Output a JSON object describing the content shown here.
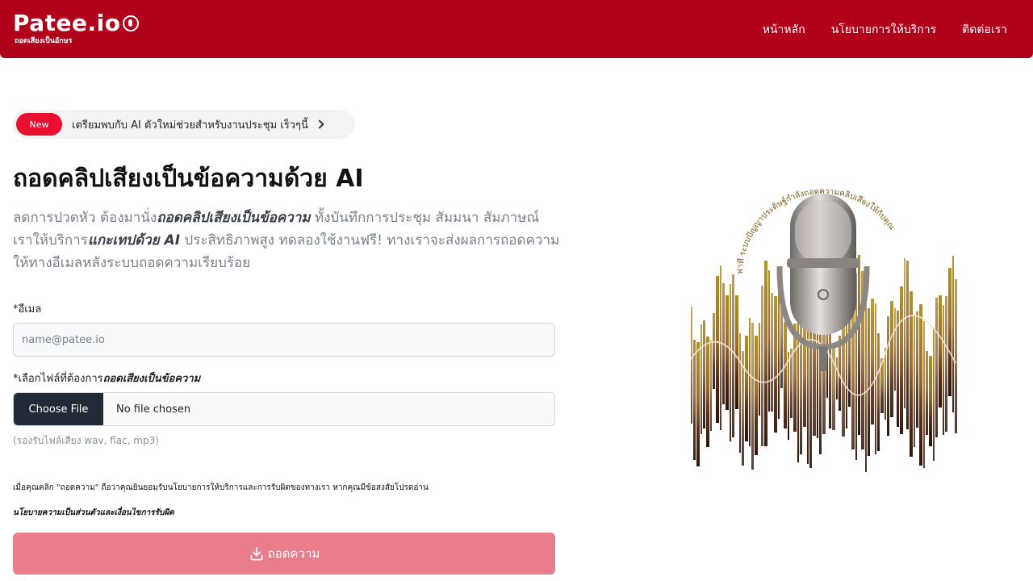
{
  "header": {
    "logo_text": "Patee.io",
    "logo_subtitle": "ถอดเสียงเป็นอักษร",
    "nav": [
      "หน้าหลัก",
      "นโยบายการให้บริการ",
      "ติดต่อเรา"
    ]
  },
  "announcement": {
    "badge": "New",
    "text": "เตรียมพบกับ AI ตัวใหม่ช่วยสำหรับงานประชุม เร็วๆนี้",
    "icon": "chevron-right-icon"
  },
  "hero": {
    "title": "ถอดคลิปเสียงเป็นข้อความด้วย AI",
    "lead_1": "ลดการปวดหัว ต้องมานั่ง",
    "lead_1_em": "ถอดคลิปเสียงเป็นข้อความ",
    "lead_2": " ทั้งบันทึกการประชุม สัมมนา สัมภาษณ์ เราให้บริการ",
    "lead_2_em": "แกะเทปด้วย AI",
    "lead_3": " ประสิทธิภาพสูง ทดลองใช้งานฟรี! ทางเราจะส่งผลการถอดความให้ทางอีเมลหลังระบบถอดความเรียบร้อย"
  },
  "form": {
    "email_label": "*อีเมล",
    "email_placeholder": "name@patee.io",
    "email_value": "",
    "file_label_prefix": "*เลือกไฟล์ที่ต้องการ",
    "file_label_em": "ถอดเสียงเป็นข้อความ",
    "file_button": "Choose File",
    "file_status": "No file chosen",
    "file_hint": "(รองรับไฟล์เสียง wav, flac, mp3)",
    "consent": "เมื่อคุณคลิก \"ถอดความ\" ถือว่าคุณยินยอมรับนโยบายการให้บริการและการรับผิดของทางเรา หากคุณมีข้อสงสัยโปรดอ่าน",
    "policy_link": "นโยบายความเป็นส่วนตัวและเงื่อนไขการรับผิด",
    "submit": "ถอดความ",
    "submit_icon": "download-icon"
  },
  "illustration": {
    "ring_text": "ฟาที ระบบปัญญาประดิษฐ์กำลังถอดความคลิปเสียงให้กับคุณ",
    "icon": "microphone-icon"
  },
  "colors": {
    "brand": "#b0001a",
    "badge": "#e8102e",
    "submit_disabled": "#e97d8c",
    "file_button": "#212a36"
  }
}
